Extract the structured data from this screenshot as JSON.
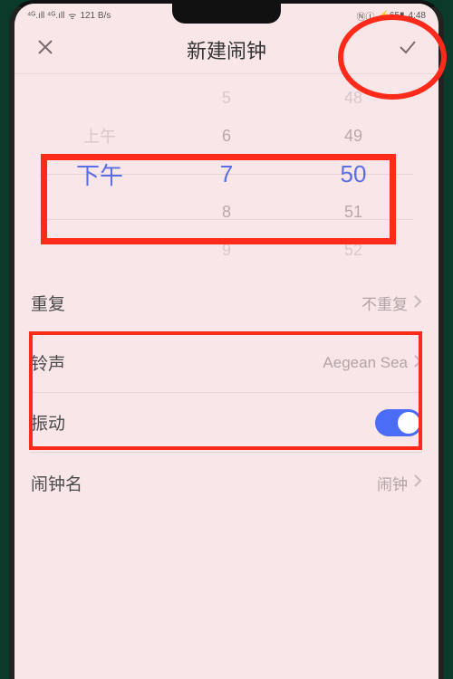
{
  "status": {
    "left1": "⁴ᴳ.ıll ⁴ᴳ.ıll",
    "left2": "ᯤ",
    "left3": "121 B/s",
    "right1": "ⓃⒾ",
    "right2": "⚡65▮",
    "right3": "4:48"
  },
  "header": {
    "title": "新建闹钟",
    "close": "close",
    "confirm": "confirm"
  },
  "picker": {
    "ampm": [
      "",
      "上午",
      "下午",
      "",
      ""
    ],
    "hour": [
      "5",
      "6",
      "7",
      "8",
      "9"
    ],
    "minute": [
      "48",
      "49",
      "50",
      "51",
      "52"
    ]
  },
  "rows": {
    "repeat": {
      "label": "重复",
      "value": "不重复"
    },
    "ringtone": {
      "label": "铃声",
      "value": "Aegean Sea"
    },
    "vibrate": {
      "label": "振动",
      "on": true
    },
    "name": {
      "label": "闹钟名",
      "value": "闹钟"
    }
  }
}
